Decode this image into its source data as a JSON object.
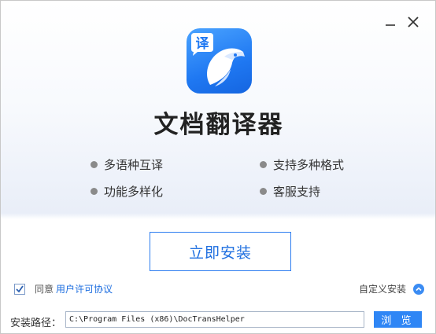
{
  "window": {
    "minimize_label": "—",
    "close_label": "×"
  },
  "app": {
    "icon_badge": "译",
    "title": "文档翻译器"
  },
  "features": [
    "多语种互译",
    "支持多种格式",
    "功能多样化",
    "客服支持"
  ],
  "install": {
    "button_label": "立即安装"
  },
  "agreement": {
    "checked": true,
    "prefix": "同意",
    "link_text": "用户许可协议"
  },
  "custom_install_label": "自定义安装",
  "path": {
    "label": "安装路径：",
    "value": "C:\\Program Files (x86)\\DocTransHelper"
  },
  "browse_label": "浏 览",
  "colors": {
    "accent": "#2f86f5",
    "link": "#1f6fe0"
  }
}
